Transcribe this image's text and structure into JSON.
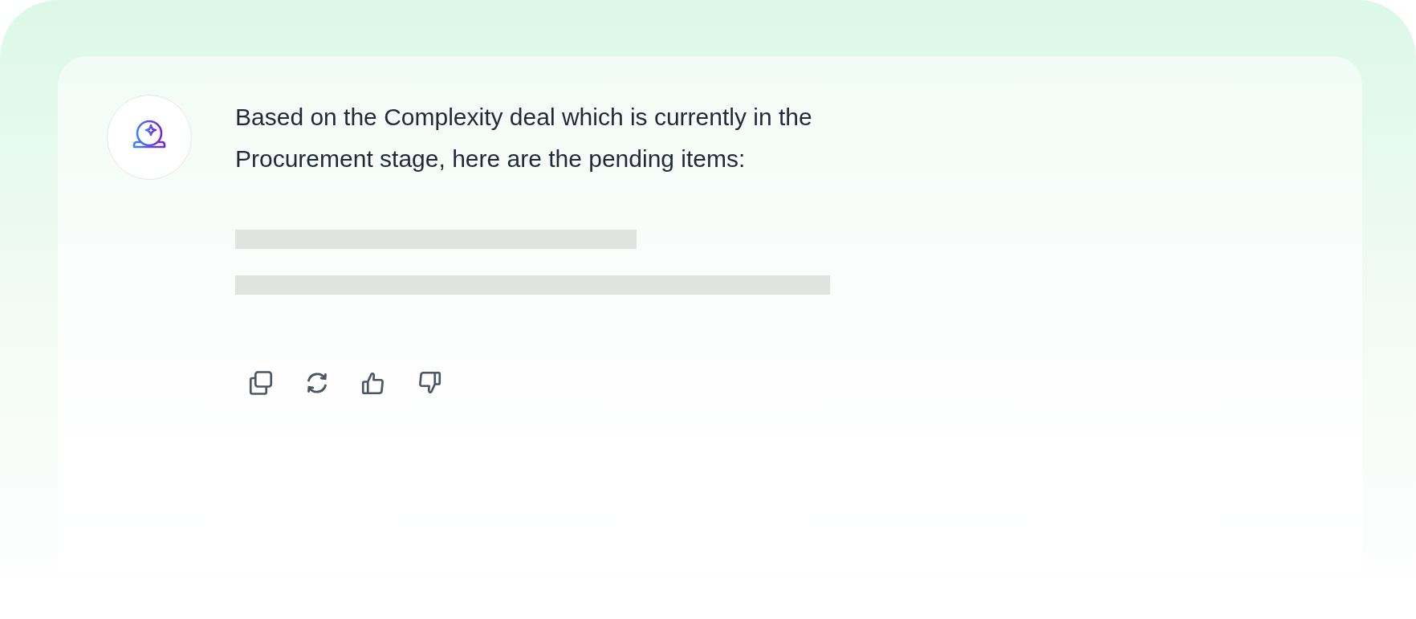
{
  "message": {
    "text": "Based on the Complexity deal which is currently in the Procurement stage, here are the pending items:",
    "loading": true
  }
}
